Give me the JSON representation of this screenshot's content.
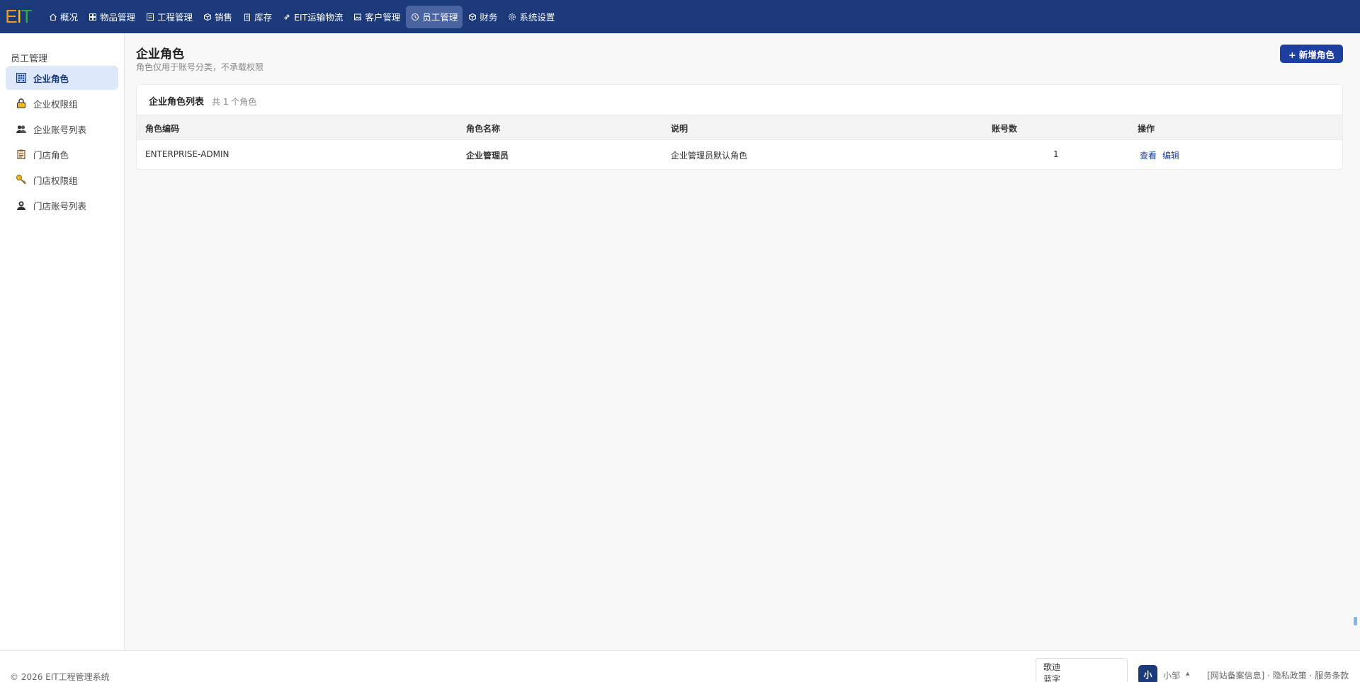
{
  "brand": {
    "logo_e": "E",
    "logo_i": "I",
    "logo_t": "T"
  },
  "nav": [
    {
      "label": "概况",
      "icon": "home-icon"
    },
    {
      "label": "物品管理",
      "icon": "grid-icon"
    },
    {
      "label": "工程管理",
      "icon": "board-icon"
    },
    {
      "label": "销售",
      "icon": "box-icon"
    },
    {
      "label": "库存",
      "icon": "clipboard-icon"
    },
    {
      "label": "EIT运输物流",
      "icon": "link-icon"
    },
    {
      "label": "客户管理",
      "icon": "image-icon"
    },
    {
      "label": "员工管理",
      "icon": "clock-icon",
      "active": true
    },
    {
      "label": "财务",
      "icon": "cube-icon"
    },
    {
      "label": "系统设置",
      "icon": "settings-icon"
    }
  ],
  "sidebar": {
    "title": "员工管理",
    "items": [
      {
        "label": "企业角色",
        "icon": "building-icon",
        "active": true
      },
      {
        "label": "企业权限组",
        "icon": "lock-icon"
      },
      {
        "label": "企业账号列表",
        "icon": "users-icon"
      },
      {
        "label": "门店角色",
        "icon": "clipboard-icon"
      },
      {
        "label": "门店权限组",
        "icon": "key-icon"
      },
      {
        "label": "门店账号列表",
        "icon": "user-icon"
      }
    ]
  },
  "main": {
    "title": "企业角色",
    "subtitle": "角色仅用于账号分类，不承载权限",
    "add_button": "+ 新增角色"
  },
  "table": {
    "title": "企业角色列表",
    "count_text": "共 1 个角色",
    "columns": [
      "角色编码",
      "角色名称",
      "说明",
      "账号数",
      "操作"
    ],
    "rows": [
      {
        "code": "ENTERPRISE-ADMIN",
        "name": "企业管理员",
        "desc": "企业管理员默认角色",
        "accounts": "1",
        "actions": [
          "查看",
          "编辑"
        ]
      }
    ]
  },
  "footer": {
    "copyright": "© 2026 EIT工程管理系统",
    "box_line1": "歌迪",
    "box_line2": "蓝字",
    "avatar_text": "小",
    "username": "小邹",
    "caret": "▲",
    "links": "[网站备案信息] · 隐私政策 · 服务条款"
  },
  "colors": {
    "topbar": "#1c3a7a",
    "accent": "#1d3fa0",
    "active_side": "#dde8fb"
  }
}
